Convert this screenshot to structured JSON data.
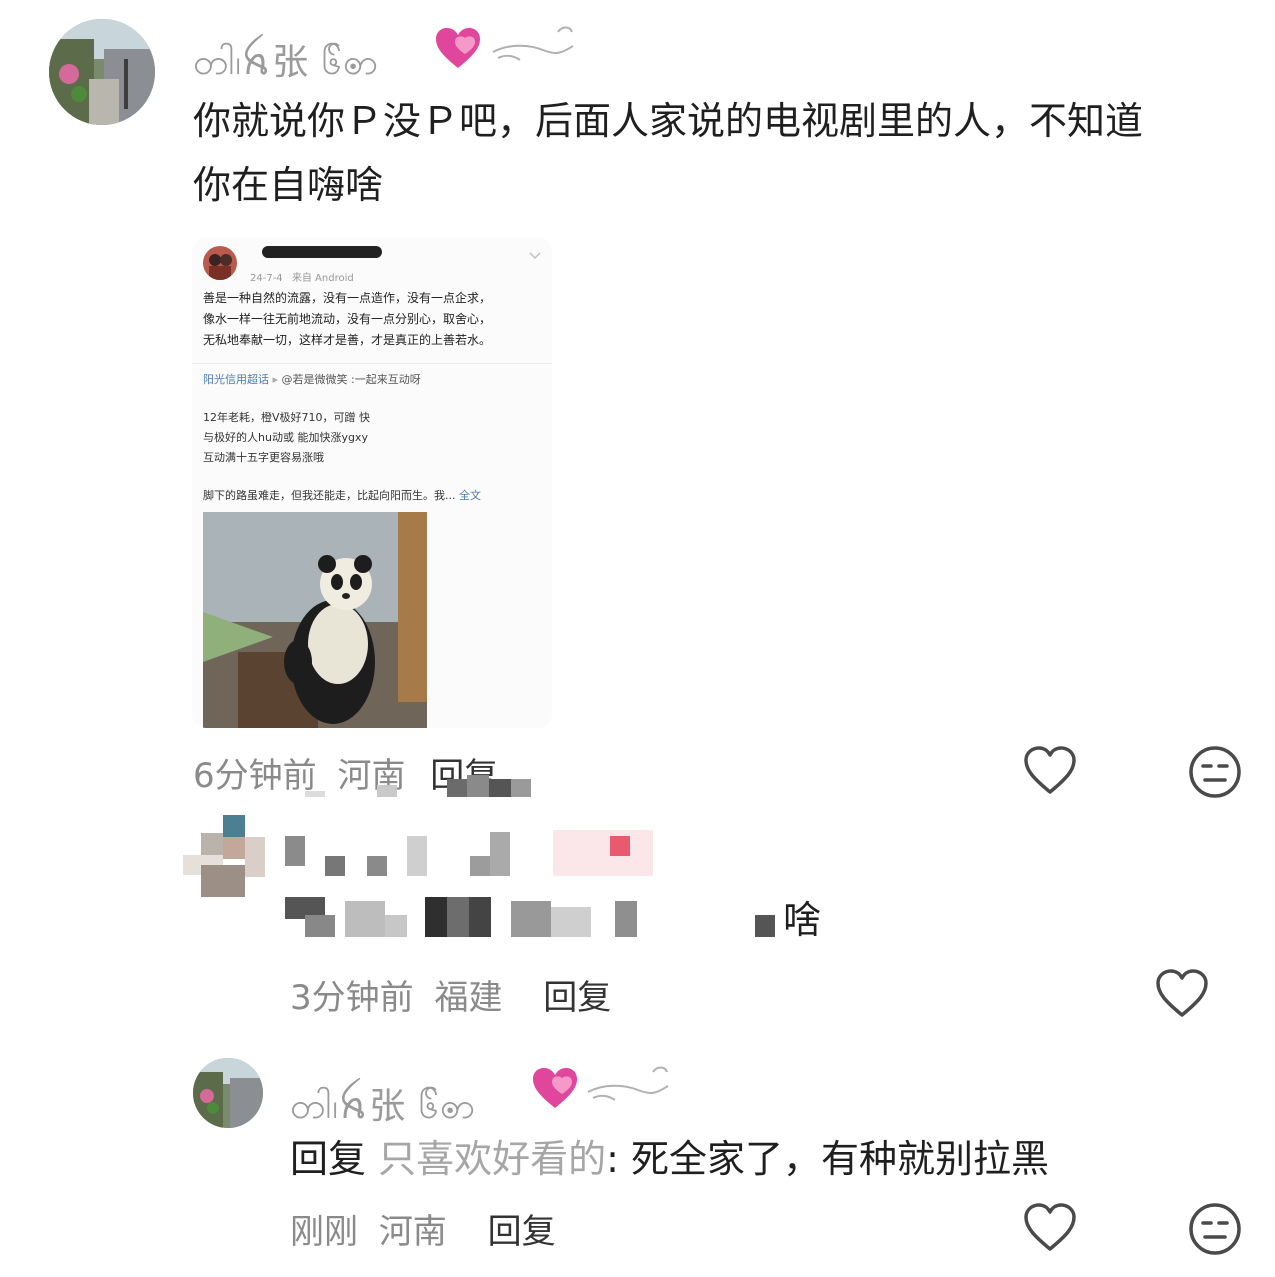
{
  "comment1": {
    "username": "တါ၊ꫝ张 ၆်ꩦ",
    "text_line1": "你就说你Ｐ没Ｐ吧，后面人家说的电视剧里的人，不知道",
    "text_line2": "你在自嗨啥",
    "time": "6分钟前",
    "location": "河南",
    "reply_label": "回复"
  },
  "embedded_post": {
    "date": "24-7-4",
    "source": "来自 Android",
    "body_line1": "善是一种自然的流露，没有一点造作，没有一点企求，",
    "body_line2": "像水一样一往无前地流动，没有一点分别心，取舍心，",
    "body_line3": "无私地奉献一切，这样才是善，才是真正的上善若水。",
    "topic": "阳光信用超话",
    "topic_user": "@若是微微笑",
    "topic_tail": ":一起来互动呀",
    "line1": "12年老耗，橙V极好710，可蹭 快",
    "line2": "与极好的人hu动或 能加快涨ygxy",
    "line3": "互动满十五字更容易涨哦",
    "excerpt": "脚下的路虽难走，但我还能走，比起向阳而生。我...",
    "more": "全文"
  },
  "comment2": {
    "text_tail": "啥",
    "time": "3分钟前",
    "location": "福建",
    "reply_label": "回复"
  },
  "comment3": {
    "username": "တါ၊ꫝ张 ၆်ꩦ",
    "reply_prefix": "回复",
    "reply_target": "只喜欢好看的",
    "text": ": 死全家了，有种就别拉黑",
    "time": "刚刚",
    "location": "河南",
    "reply_label": "回复"
  },
  "icons": {
    "like": "heart-outline-icon",
    "dislike": "meh-face-icon",
    "decor": "sparkling-heart-icon"
  },
  "colors": {
    "name_gray": "#9a9a9a",
    "meta_gray": "#8a8a8a",
    "text": "#1f1f1f",
    "pink_heart": "#e0479c"
  }
}
